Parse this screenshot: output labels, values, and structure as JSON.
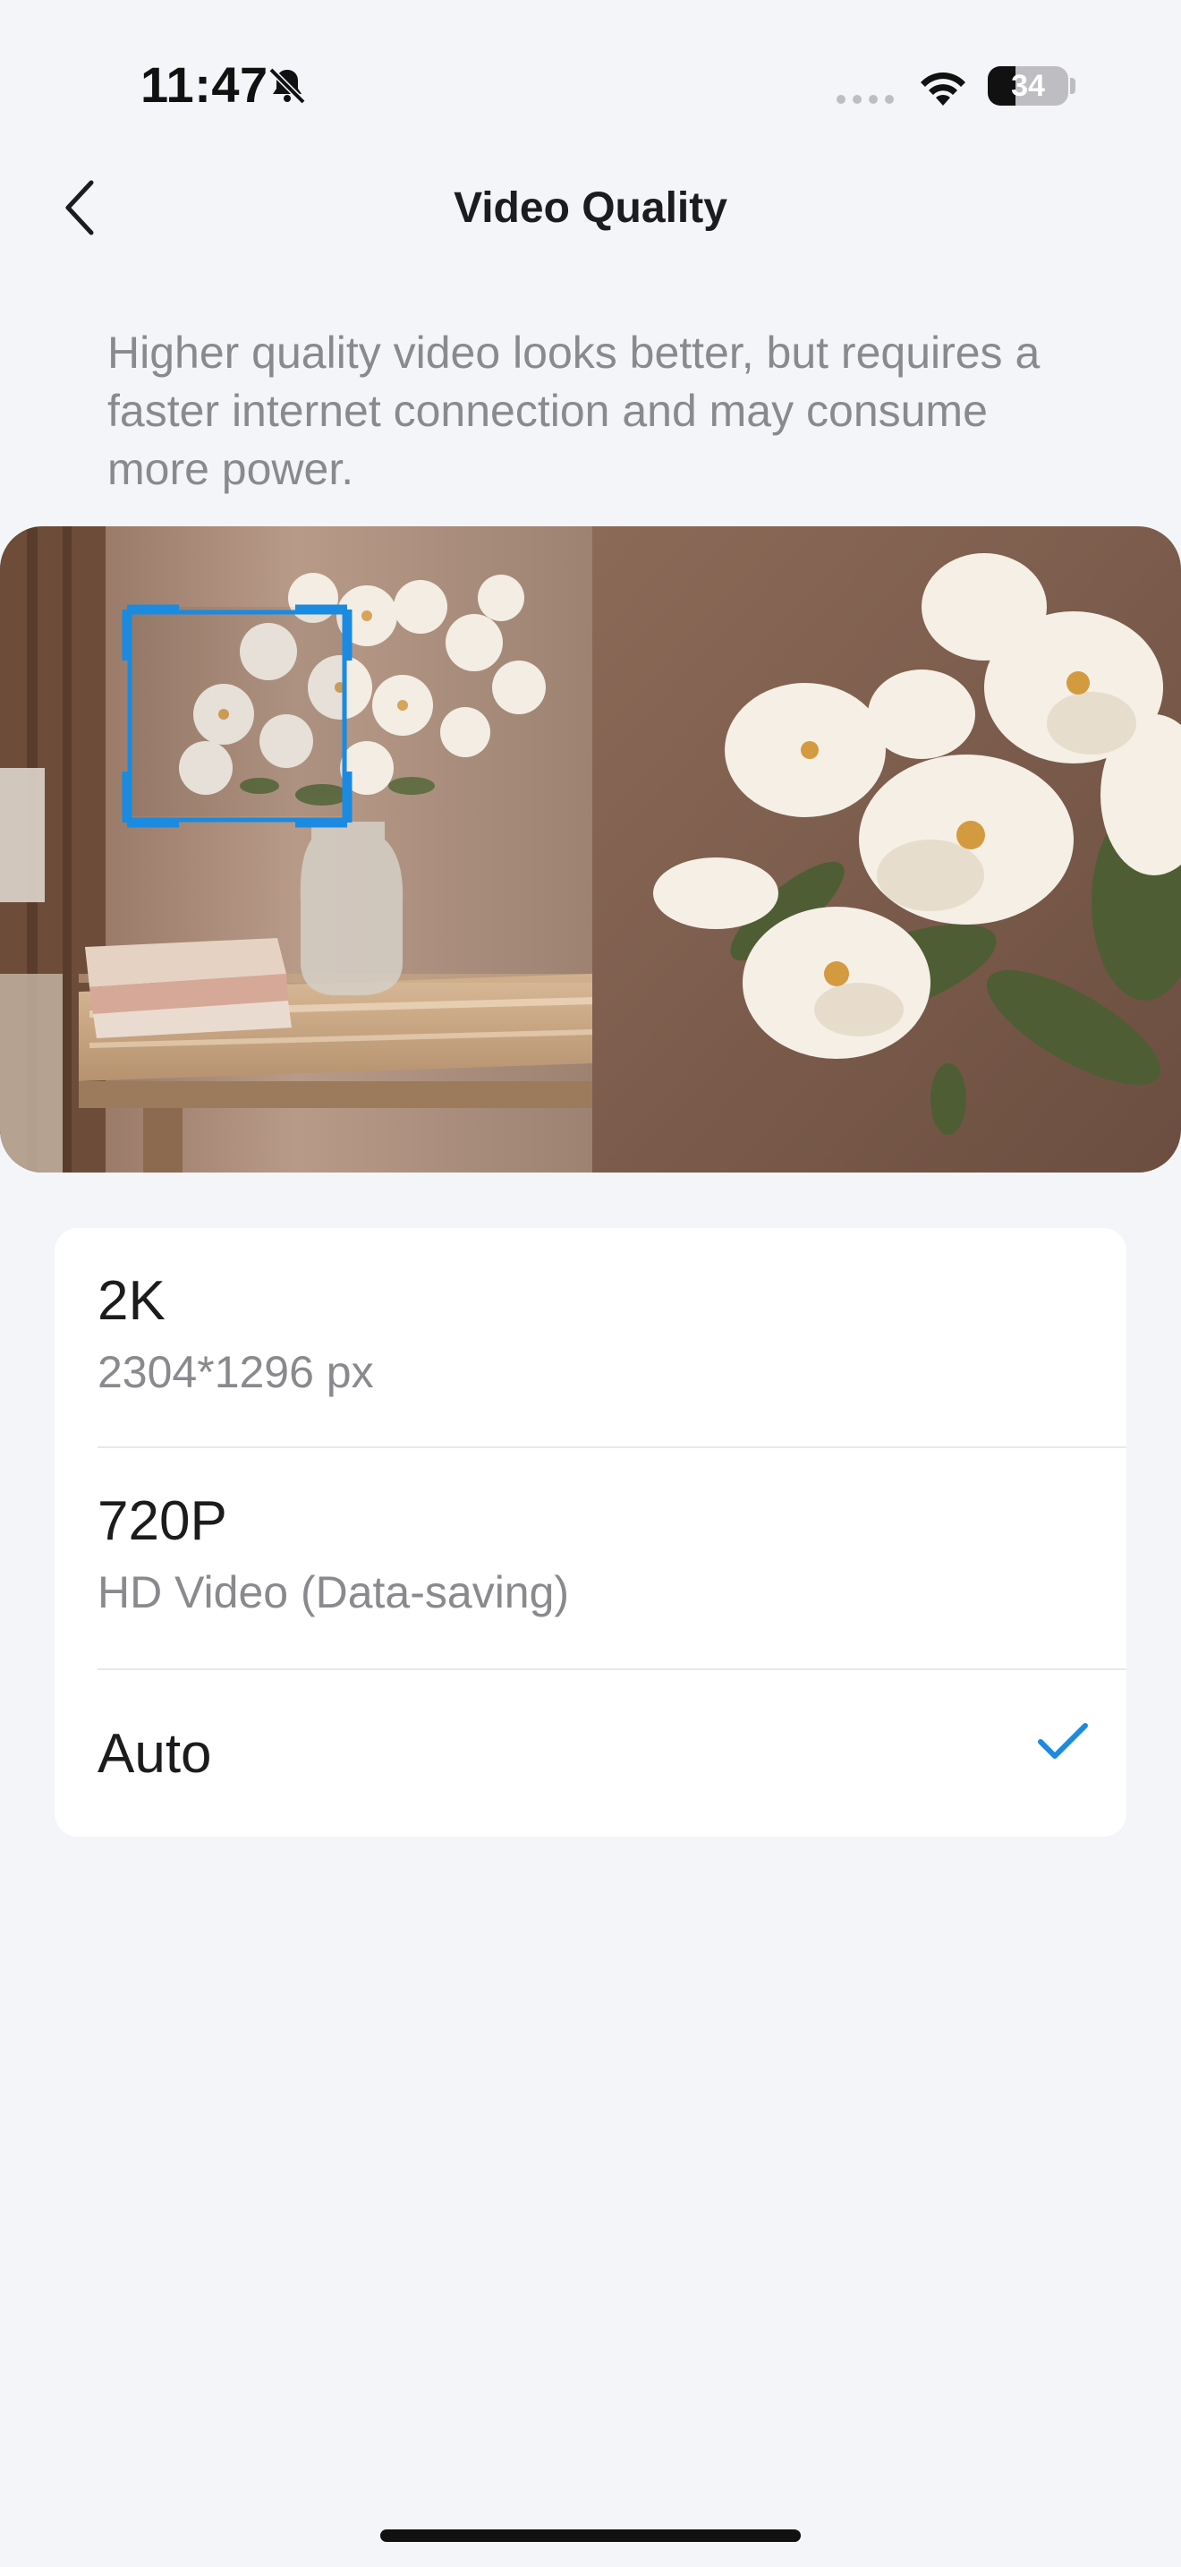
{
  "status_bar": {
    "time": "11:47",
    "battery_level": "34",
    "battery_percent": 34
  },
  "header": {
    "title": "Video Quality",
    "back_icon": "chevron-left-icon"
  },
  "description": "Higher quality video looks better, but requires a faster internet connection and may consume more power.",
  "preview": {
    "left_image": "flower-vase-on-table-scene",
    "right_image": "zoomed-flower-closeup",
    "selection_frame_color": "#1a8be0"
  },
  "options": [
    {
      "title": "2K",
      "subtitle": "2304*1296 px",
      "selected": false
    },
    {
      "title": "720P",
      "subtitle": "HD Video (Data-saving)",
      "selected": false
    },
    {
      "title": "Auto",
      "subtitle": "",
      "selected": true
    }
  ],
  "colors": {
    "accent": "#1a8be0",
    "background": "#f4f5f9",
    "card": "#ffffff",
    "secondary_text": "#8a8a8e"
  }
}
